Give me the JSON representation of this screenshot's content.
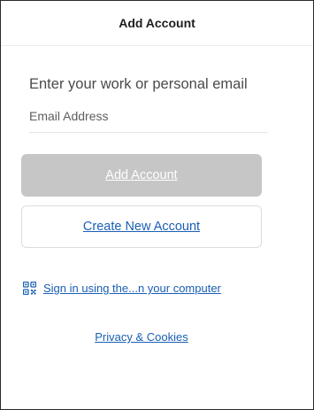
{
  "header": {
    "title": "Add Account"
  },
  "form": {
    "prompt": "Enter your work or personal email",
    "email_placeholder": "Email Address",
    "email_value": ""
  },
  "buttons": {
    "add_account_label": "Add Account",
    "create_account_label": "Create New Account"
  },
  "links": {
    "qr_icon": "qr-code-icon",
    "qr_signin_label": "Sign in using the...n your computer",
    "privacy_label": "Privacy & Cookies"
  },
  "colors": {
    "link_blue": "#1a5fb4",
    "disabled_button": "#c6c6c6"
  }
}
